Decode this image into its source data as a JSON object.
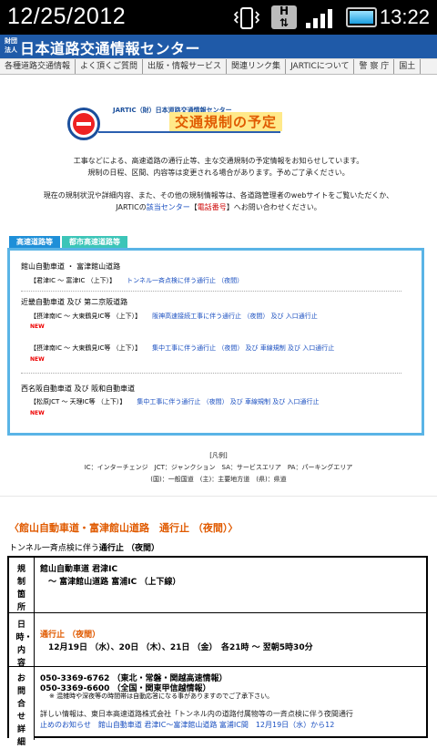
{
  "statusbar": {
    "date": "12/25/2012",
    "time": "13:22",
    "network_label": "H"
  },
  "header": {
    "emblem": "財団法人",
    "title": "日本道路交通情報センター"
  },
  "nav": {
    "items": [
      "各種道路交通情報",
      "よく頂くご質問",
      "出版・情報サービス",
      "関連リンク集",
      "JARTICについて",
      "警 察 庁",
      "国土"
    ]
  },
  "banner": {
    "org_line": "JARTIC（財）日本道路交通情報センター",
    "title": "交通規制の予定"
  },
  "intro": {
    "line1": "工事などによる、高速道路の通行止等、主な交通規制の予定情報をお知らせしています。",
    "line2": "規制の日程、区間、内容等は変更される場合があります。予めご了承ください。",
    "line3": "現在の規制状況や詳細内容、また、その他の規制情報等は、各道路管理者のwebサイトをご覧いただくか、",
    "line4_a": "JARTICの",
    "line4_link": "該当センター",
    "line4_b": "【",
    "line4_red": "電話番号",
    "line4_c": "】へお問い合わせください。"
  },
  "tabs": [
    "高速道路等",
    "都市高速道路等"
  ],
  "regulations": [
    {
      "road": "館山自動車道 ・ 富津館山道路",
      "segments": [
        {
          "section": "【君津IC ～ 富津IC （上下）】",
          "link": "トンネル一斉点検に伴う通行止 （夜間）",
          "new": false
        }
      ]
    },
    {
      "road": "近畿自動車道 及び 第二京阪道路",
      "segments": [
        {
          "section": "【摂津南IC ～ 大東鶴見IC等 （上下）】",
          "link": "阪神高速接続工事に伴う通行止 （夜間） 及び 入口通行止",
          "new": true
        },
        {
          "section": "【摂津南IC ～ 大東鶴見IC等 （上下）】",
          "link": "集中工事に伴う通行止 （夜間） 及び 車線規制 及び 入口通行止",
          "new": true
        }
      ]
    },
    {
      "road": "西名阪自動車道 及び 阪和自動車道",
      "segments": [
        {
          "section": "【松原JCT ～ 天理IC等 （上下）】",
          "link": "集中工事に伴う通行止 （夜間） 及び 車線規制 及び 入口通行止",
          "new": true
        }
      ]
    }
  ],
  "new_label": "NEW",
  "legend": {
    "title": "[凡例]",
    "line1": "IC：インターチェンジ　JCT：ジャンクション　SA：サービスエリア　PA：パーキングエリア",
    "line2": "(国)：一般国道　(主)：主要地方道　(県)：県道"
  },
  "detail": {
    "title": "〈館山自動車道・富津館山道路　通行止 （夜間）〉",
    "subtitle_pre": "トンネル一斉点検に伴う",
    "subtitle_bold": "通行止 （夜間）",
    "rows": [
      {
        "head": "規制箇所",
        "lines": [
          "館山自動車道 君津IC",
          "　～ 富津館山道路 富浦IC （上下線）"
        ]
      },
      {
        "head": "日時・内容",
        "lines": [
          "通行止 （夜間）",
          "　12月19日 （水）、20日 （木）、21日 （金）　各21時 ～ 翌朝5時30分"
        ]
      },
      {
        "head": "お問合せ詳細",
        "lines": [
          "050-3369-6762 （東北・常磐・関越高速情報）",
          "050-3369-6600 （全国・関東甲信越情報）",
          "※ 混雑時や深夜等の時間帯は自動応答になる事がありますのでご了承下さい。",
          "詳しい情報は、東日本高速道路株式会社「トンネル内の道路付属物等の一斉点検に伴う夜間通行",
          "止めのお知らせ　館山自動車道 君津IC～富津館山道路 富浦IC間　12月19日（水）から12"
        ]
      }
    ]
  }
}
